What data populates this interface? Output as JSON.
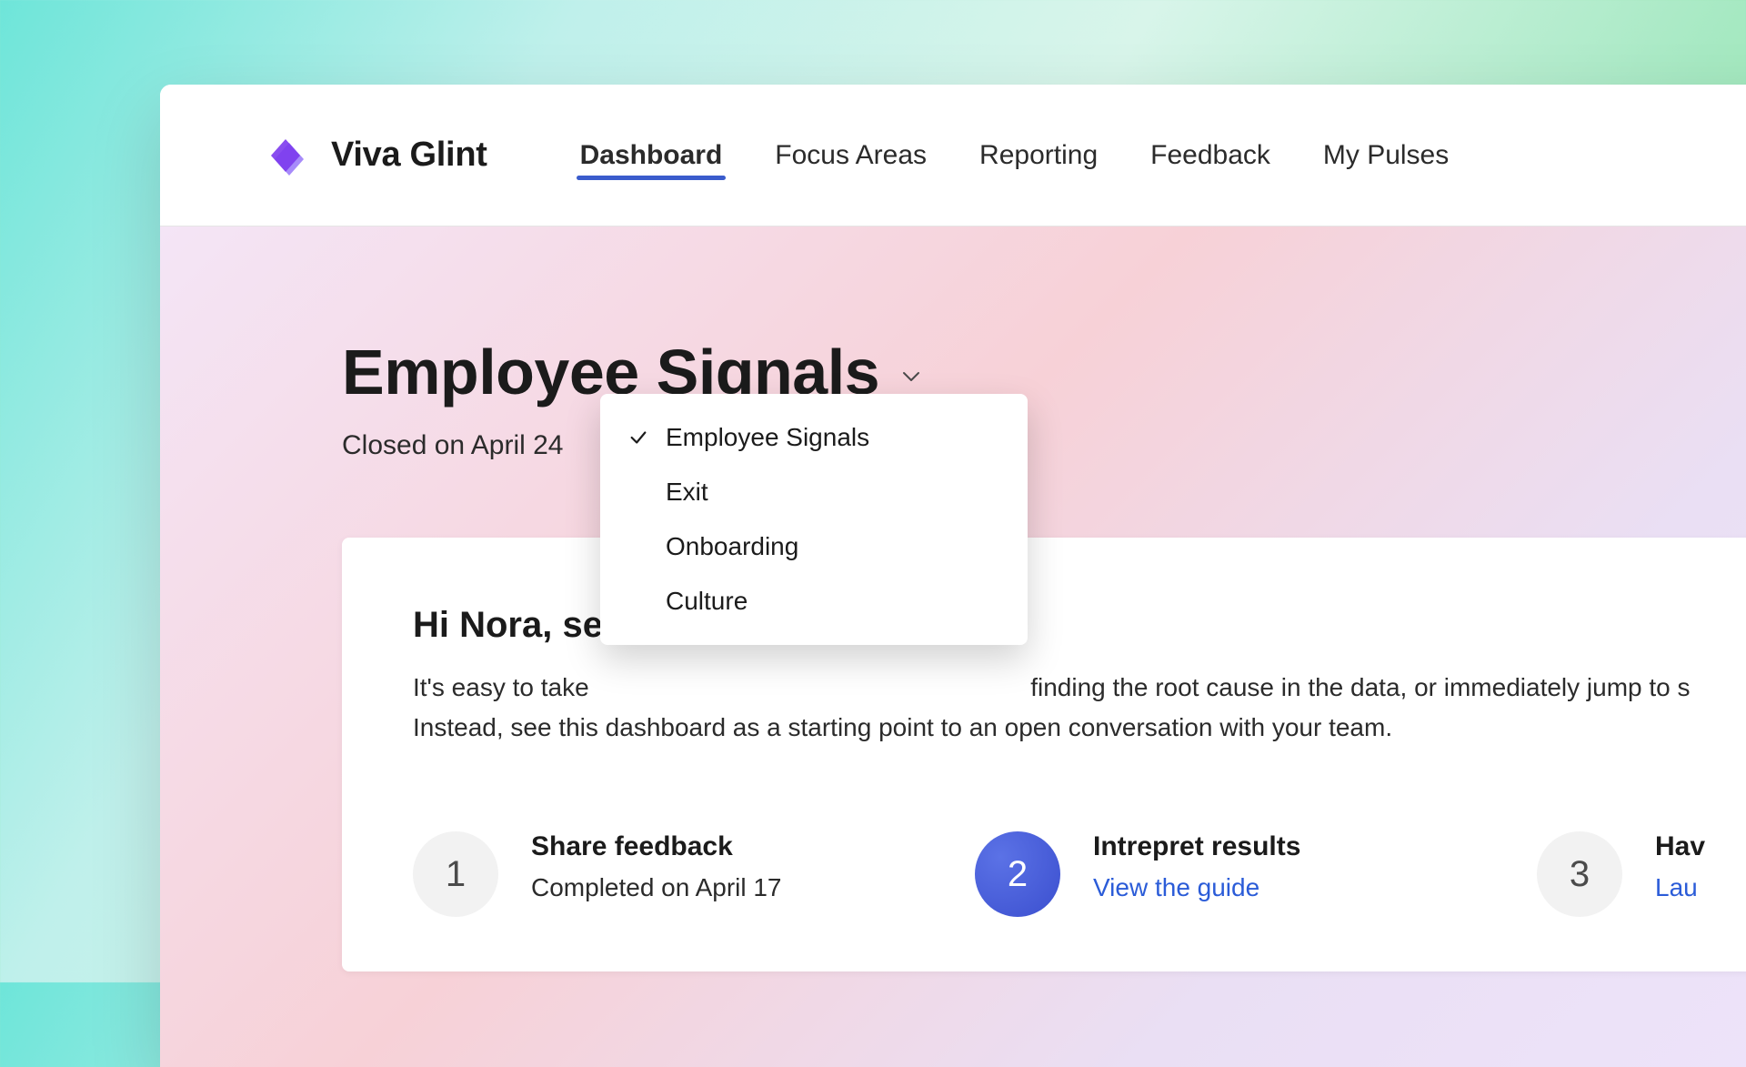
{
  "brand": {
    "name": "Viva Glint"
  },
  "nav": {
    "items": [
      {
        "label": "Dashboard",
        "active": true
      },
      {
        "label": "Focus Areas",
        "active": false
      },
      {
        "label": "Reporting",
        "active": false
      },
      {
        "label": "Feedback",
        "active": false
      },
      {
        "label": "My Pulses",
        "active": false
      }
    ]
  },
  "page": {
    "title": "Employee Signals",
    "subtitle": "Closed on April 24"
  },
  "dropdown": {
    "items": [
      {
        "label": "Employee Signals",
        "selected": true
      },
      {
        "label": "Exit",
        "selected": false
      },
      {
        "label": "Onboarding",
        "selected": false
      },
      {
        "label": "Culture",
        "selected": false
      }
    ]
  },
  "card": {
    "title_visible_prefix": "Hi Nora, se",
    "body_line1_tail": "finding the root cause in the data, or immediately jump to s",
    "body_line1_head": "It's easy to take",
    "body_line2": "Instead, see this dashboard as a starting point to an open conversation with your team."
  },
  "steps": [
    {
      "number": "1",
      "title": "Share feedback",
      "sub": "Completed on April 17",
      "style": "muted"
    },
    {
      "number": "2",
      "title": "Intrepret results",
      "link": "View the guide",
      "style": "primary"
    },
    {
      "number": "3",
      "title": "Hav",
      "link": "Lau",
      "style": "muted"
    }
  ]
}
